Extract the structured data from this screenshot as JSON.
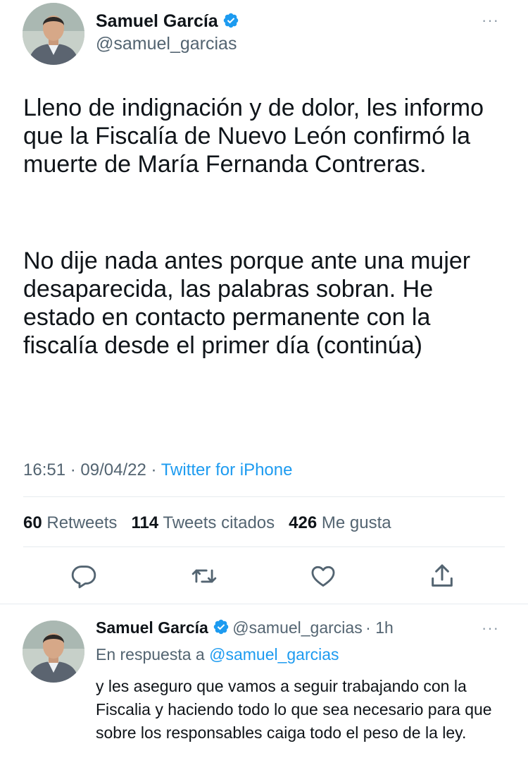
{
  "main_tweet": {
    "author_name": "Samuel García",
    "author_handle": "@samuel_garcias",
    "more_label": "···",
    "paragraphs": [
      "Lleno de indignación y de dolor, les informo que la Fiscalía de Nuevo León confirmó la muerte de María Fernanda Contreras.",
      "No dije nada antes porque ante una mujer desaparecida, las palabras sobran. He estado en contacto permanente con la fiscalía desde el primer día (continúa)"
    ],
    "time": "16:51",
    "date": "09/04/22",
    "separator": " · ",
    "source": "Twitter for iPhone",
    "stats": {
      "retweets_count": "60",
      "retweets_label": "Retweets",
      "quotes_count": "114",
      "quotes_label": "Tweets citados",
      "likes_count": "426",
      "likes_label": "Me gusta"
    }
  },
  "reply_tweet": {
    "author_name": "Samuel García",
    "author_handle": "@samuel_garcias",
    "age": "· 1h",
    "more_label": "···",
    "in_reply_prefix": "En respuesta a",
    "in_reply_handle": "@samuel_garcias",
    "text": "y les aseguro que vamos a seguir trabajando con la Fiscalia y haciendo todo lo que sea necesario para que sobre los responsables caiga todo el peso de la ley."
  },
  "icons": [
    "verified-badge-icon",
    "reply-icon",
    "retweet-icon",
    "like-icon",
    "share-icon",
    "more-icon"
  ],
  "colors": {
    "accent": "#1d9bf0",
    "secondary_text": "#536471",
    "text": "#0f1419",
    "divider": "#e6ebef"
  }
}
